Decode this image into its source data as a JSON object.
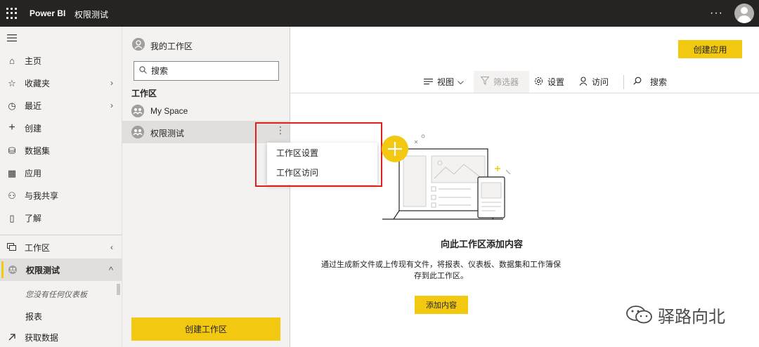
{
  "topbar": {
    "brand": "Power BI",
    "workspace_crumb": "权限测试",
    "more": "···"
  },
  "nav": {
    "items": [
      {
        "label": "主页",
        "icon": "home-icon",
        "glyph": "⌂"
      },
      {
        "label": "收藏夹",
        "icon": "star-icon",
        "glyph": "☆",
        "chevron": "›"
      },
      {
        "label": "最近",
        "icon": "clock-icon",
        "glyph": "◷",
        "chevron": "›"
      },
      {
        "label": "创建",
        "icon": "plus-icon",
        "glyph": "+"
      },
      {
        "label": "数据集",
        "icon": "database-icon",
        "glyph": "⛁"
      },
      {
        "label": "应用",
        "icon": "apps-icon",
        "glyph": "▦"
      },
      {
        "label": "与我共享",
        "icon": "share-icon",
        "glyph": "⚇"
      },
      {
        "label": "了解",
        "icon": "book-icon",
        "glyph": "▯"
      }
    ],
    "workspaces": {
      "label": "工作区",
      "chevron": "‹"
    },
    "current": {
      "label": "权限测试",
      "chevron": "^"
    },
    "empty_note": "您没有任何仪表板",
    "reports": "报表",
    "get_data": "获取数据"
  },
  "flyout": {
    "my_workspace": "我的工作区",
    "search_placeholder": "搜索",
    "heading": "工作区",
    "workspaces": [
      {
        "label": "My Space"
      },
      {
        "label": "权限测试"
      }
    ],
    "more": "⋮",
    "create_button": "创建工作区"
  },
  "context_menu": {
    "items": [
      {
        "label": "工作区设置"
      },
      {
        "label": "工作区访问"
      }
    ]
  },
  "main": {
    "create_app": "创建应用",
    "toolbar": {
      "view": "视图",
      "filter": "筛选器",
      "settings": "设置",
      "access": "访问",
      "search": "搜索"
    },
    "empty_title": "向此工作区添加内容",
    "empty_desc": "通过生成新文件或上传现有文件，将报表、仪表板、数据集和工作簿保存到此工作区。",
    "add_content": "添加内容"
  },
  "watermark": {
    "text": "驿路向北"
  },
  "colors": {
    "accent": "#f2c811",
    "topbar": "#252423",
    "highlight": "#e02020"
  }
}
